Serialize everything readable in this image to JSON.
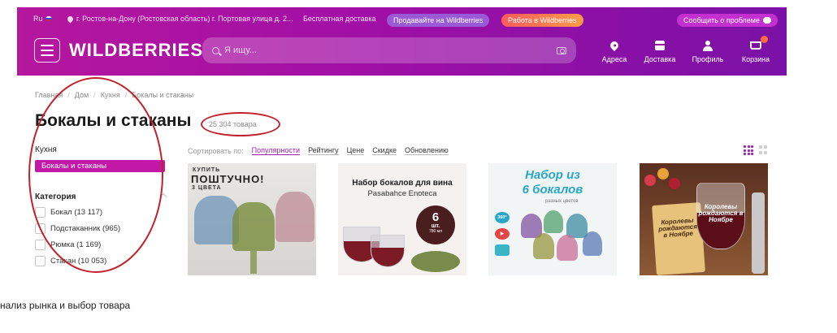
{
  "topbar": {
    "lang": "Ru",
    "address": "г. Ростов-на-Дону (Ростовская область) г. Портовая улица д. 2...",
    "free_delivery": "Бесплатная доставка",
    "sell_pill": "Продавайте на Wildberries",
    "work_pill": "Работа в Wildberries",
    "report_pill": "Сообщить о проблеме"
  },
  "header": {
    "logo": "WILDBERRIES",
    "search_placeholder": "Я ищу...",
    "nav": {
      "addresses": "Адреса",
      "delivery": "Доставка",
      "profile": "Профиль",
      "cart": "Корзина"
    }
  },
  "breadcrumb": [
    "Главная",
    "Дом",
    "Кухня",
    "Бокалы и стаканы"
  ],
  "page": {
    "title": "Бокалы и стаканы",
    "count": "25 304 товара"
  },
  "sidebar": {
    "parent": "Кухня",
    "active": "Бокалы и стаканы",
    "category_heading": "Категория",
    "categories": [
      "Бокал (13 117)",
      "Подстаканник (965)",
      "Рюмка (1 169)",
      "Стакан (10 053)"
    ]
  },
  "sort": {
    "label": "Сортировать по:",
    "options": [
      "Популярности",
      "Рейтингу",
      "Цене",
      "Скидке",
      "Обновлению"
    ],
    "active_index": 0
  },
  "products": [
    {
      "lines": [
        "КУПИТЬ",
        "ПОШТУЧНО!",
        "3 ЦВЕТА"
      ]
    },
    {
      "lines": [
        "Набор бокалов для вина",
        "Pasabahce Enoteca"
      ],
      "badge": [
        "6",
        "шт.",
        "780 мл"
      ]
    },
    {
      "lines": [
        "Набор из",
        "6 бокалов",
        "разных цветов"
      ],
      "side_badges": [
        "360°",
        "▶",
        ""
      ]
    },
    {
      "lines": [
        "Королевы рождаются в Ноябре",
        "Королевы рождаются в Ноябре"
      ]
    }
  ],
  "caption": "нализ рынка и выбор товара",
  "colors": {
    "brand_gradient_start": "#b5179e",
    "brand_gradient_end": "#7a11a6",
    "accent": "#c218a8",
    "annotation": "#c2202a"
  }
}
